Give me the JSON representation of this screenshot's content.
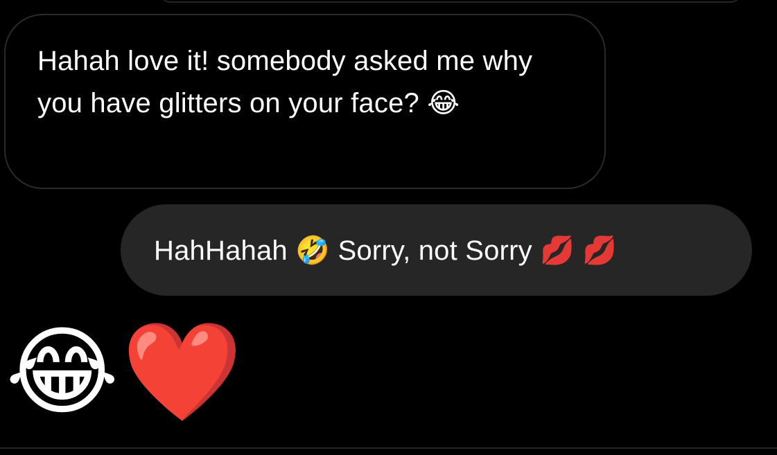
{
  "thread": {
    "messages": [
      {
        "direction": "received",
        "text": "Hahah love it! somebody asked me why you have glitters on your face? 😂"
      },
      {
        "direction": "sent",
        "text": "HahHahah 🤣 Sorry, not Sorry 💋 💋"
      },
      {
        "direction": "received",
        "text": "😂❤️"
      }
    ]
  },
  "colors": {
    "background": "#000000",
    "received_bubble_border": "#2a2a2a",
    "sent_bubble_fill": "#262626",
    "text": "#ffffff"
  }
}
